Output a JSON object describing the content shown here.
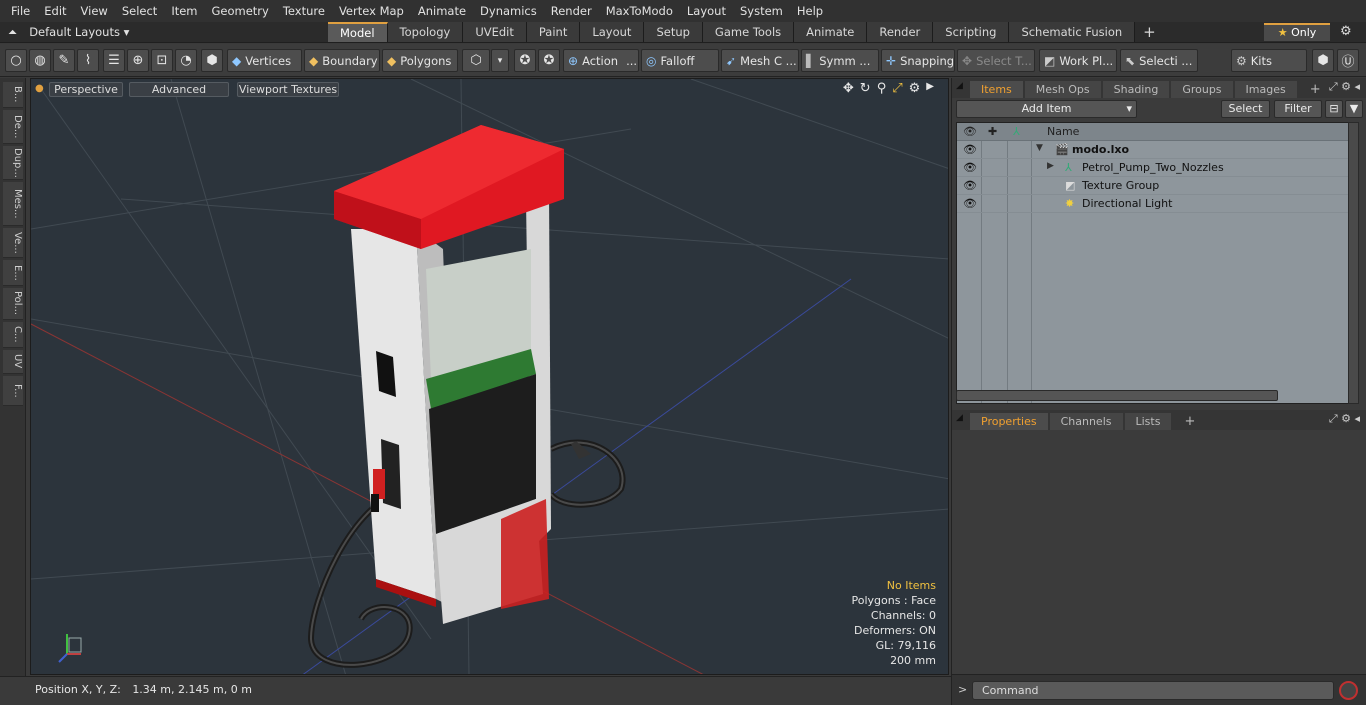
{
  "menu": [
    "File",
    "Edit",
    "View",
    "Select",
    "Item",
    "Geometry",
    "Texture",
    "Vertex Map",
    "Animate",
    "Dynamics",
    "Render",
    "MaxToModo",
    "Layout",
    "System",
    "Help"
  ],
  "layout_selector": "Default Layouts",
  "layout_tabs": [
    "Model",
    "Topology",
    "UVEdit",
    "Paint",
    "Layout",
    "Setup",
    "Game Tools",
    "Animate",
    "Render",
    "Scripting",
    "Schematic Fusion"
  ],
  "active_layout_tab": "Model",
  "only_label": "Only",
  "toolbar": {
    "vertices": "Vertices",
    "boundary": "Boundary",
    "polygons": "Polygons",
    "action": "Action",
    "falloff": "Falloff",
    "mesh_c": "Mesh C ...",
    "symmetry": "Symm ...",
    "snapping": "Snapping",
    "select_t": "Select T...",
    "work_plane": "Work Pl...",
    "selection": "Selecti ...",
    "kits": "Kits"
  },
  "left_tabs": [
    "B...",
    "De...",
    "Dup...",
    "Mes...",
    "Ve...",
    "E...",
    "Pol...",
    "C...",
    "UV",
    "F..."
  ],
  "viewport": {
    "view_mode": "Perspective",
    "advanced": "Advanced",
    "textures": "Viewport Textures",
    "stats": {
      "items": "No Items",
      "polygons": "Polygons : Face",
      "channels": "Channels: 0",
      "deformers": "Deformers: ON",
      "gl": "GL: 79,116",
      "scale": "200 mm"
    }
  },
  "status": {
    "position_label": "Position X, Y, Z:",
    "position_value": "1.34 m, 2.145 m, 0 m"
  },
  "items_panel": {
    "tabs": [
      "Items",
      "Mesh Ops",
      "Shading",
      "Groups",
      "Images"
    ],
    "active_tab": "Items",
    "add_item": "Add Item",
    "select": "Select",
    "filter": "Filter",
    "name_header": "Name",
    "rows": [
      {
        "name": "modo.lxo",
        "bold": true
      },
      {
        "name": "Petrol_Pump_Two_Nozzles",
        "bold": false
      },
      {
        "name": "Texture Group",
        "bold": false
      },
      {
        "name": "Directional Light",
        "bold": false
      }
    ]
  },
  "properties_panel": {
    "tabs": [
      "Properties",
      "Channels",
      "Lists"
    ],
    "active_tab": "Properties"
  },
  "command_placeholder": "Command",
  "colors": {
    "accent": "#f0a030",
    "viewport_bg": "#2c343c",
    "pump_red": "#e01822",
    "pump_white": "#e8e8e8"
  }
}
